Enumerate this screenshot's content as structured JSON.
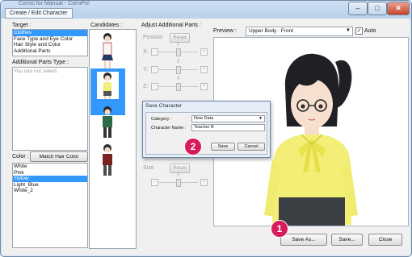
{
  "window": {
    "title": "Comic for Manual - ComiPo!",
    "tab_title": "Create / Edit Character",
    "minimize": "–",
    "maximize": "□",
    "close": "✕"
  },
  "target": {
    "label": "Target :",
    "items": [
      "Clothes",
      "Face Type and Eye Color",
      "Hair Style and Color",
      "Additional Parts"
    ],
    "selected_index": 0
  },
  "additional_parts": {
    "label": "Additional Parts Type :",
    "message": "You can not select."
  },
  "color": {
    "label": "Color :",
    "match_button": "Match Hair Color",
    "items": [
      "White",
      "Pink",
      "Yellow",
      "Light_Blue",
      "White_2"
    ],
    "selected_index": 2
  },
  "candidates": {
    "label": "Candidates :"
  },
  "adjust": {
    "label": "Adjust Additional Parts :",
    "position_label": "Position",
    "reset_label": "Reset",
    "x_label": "X:",
    "y_label": "Y:",
    "z_label": "Z:",
    "size_label": "Size",
    "zero": "0",
    "minus": "-",
    "plus": "+"
  },
  "preview": {
    "label": "Preview :",
    "view_value": "Upper Body : Front",
    "auto_label": "Auto",
    "auto_checked": true
  },
  "dialog": {
    "title": "Save Character",
    "category_label": "Category :",
    "category_value": "New Data",
    "name_label": "Character Name :",
    "name_value": "Teacher B",
    "save_button": "Save",
    "cancel_button": "Cancel"
  },
  "footer": {
    "save_as": "Save As...",
    "save": "Save...",
    "close": "Close"
  },
  "badges": {
    "one": "1",
    "two": "2"
  },
  "colors": {
    "accent": "#3399ff",
    "badge": "#d81b5c"
  }
}
